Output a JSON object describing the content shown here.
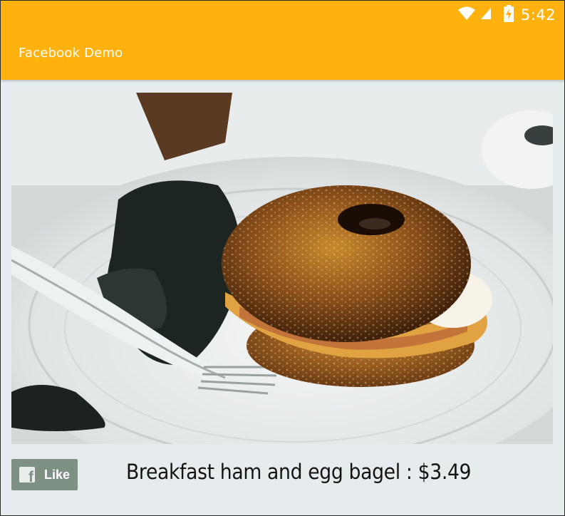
{
  "status_bar": {
    "time": "5:42",
    "icons": [
      "wifi-icon",
      "cell-signal-icon",
      "battery-charging-icon"
    ]
  },
  "app_bar": {
    "title": "Facebook Demo",
    "color": "#ffb20e"
  },
  "content": {
    "image": {
      "description_icon": "food-photo",
      "alt": "Breakfast ham and egg bagel"
    },
    "like_button": {
      "label": "Like",
      "icon": "facebook-icon",
      "color": "#7e8f84"
    },
    "caption": "Breakfast ham and egg bagel : $3.49"
  }
}
